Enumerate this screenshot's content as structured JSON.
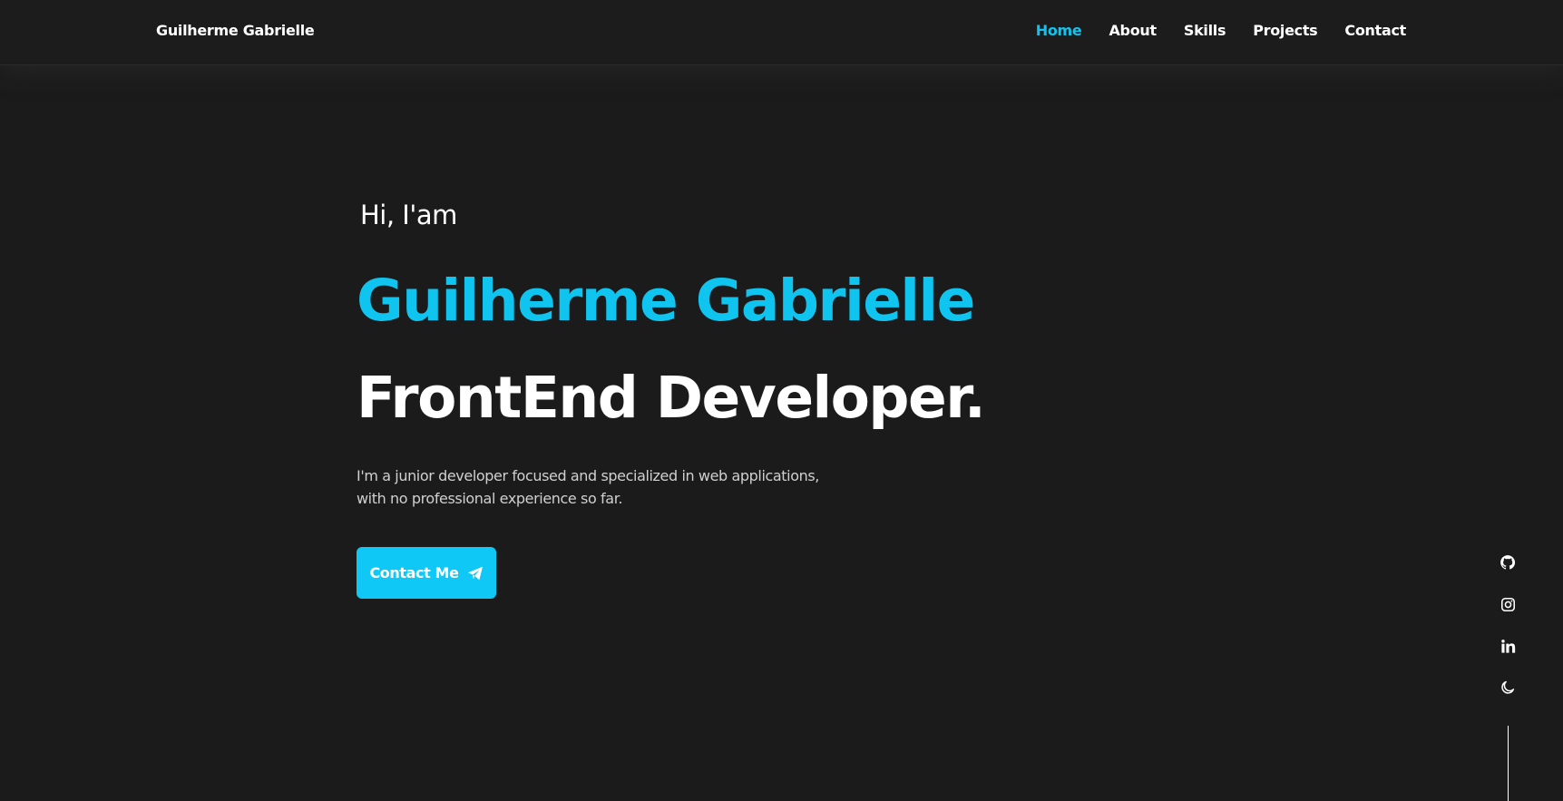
{
  "header": {
    "logo": "Guilherme Gabrielle",
    "nav": [
      {
        "label": "Home",
        "active": true
      },
      {
        "label": "About",
        "active": false
      },
      {
        "label": "Skills",
        "active": false
      },
      {
        "label": "Projects",
        "active": false
      },
      {
        "label": "Contact",
        "active": false
      }
    ]
  },
  "hero": {
    "greeting": "Hi, I'am",
    "name": "Guilherme Gabrielle",
    "role": "FrontEnd Developer.",
    "description_line1": "I'm a junior developer focused and specialized in web applications,",
    "description_line2": "with no professional experience so far.",
    "cta_label": "Contact Me",
    "cta_icon": "paper-plane-icon"
  },
  "socials": [
    {
      "icon": "github-icon"
    },
    {
      "icon": "instagram-icon"
    },
    {
      "icon": "linkedin-icon"
    },
    {
      "icon": "moon-icon"
    }
  ],
  "colors": {
    "accent": "#10c4f0",
    "background": "#1b1b1b",
    "text": "#ffffff",
    "muted_text": "#d0d0d0"
  }
}
